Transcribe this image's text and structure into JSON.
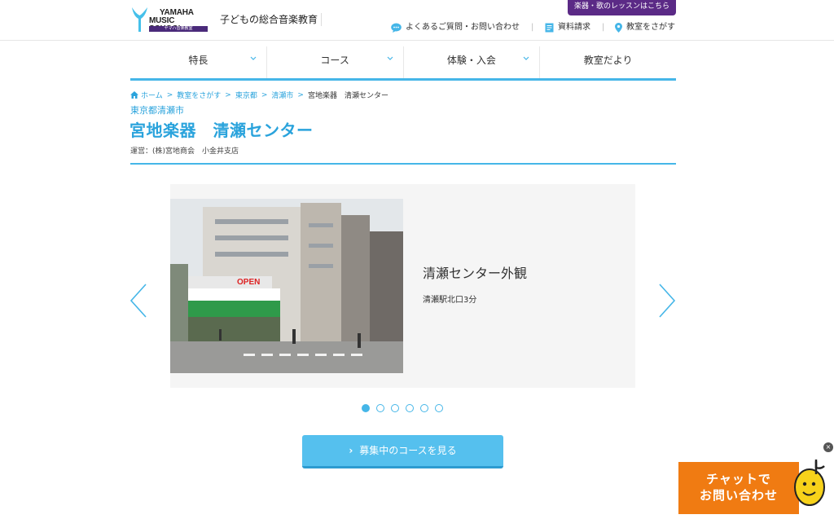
{
  "header": {
    "logo": {
      "line1": "YAMAHA",
      "line2": "MUSIC SCHOOL",
      "bar": "ヤマハ音楽教室"
    },
    "tagline": "子どもの総合音楽教育",
    "lesson_button": "楽器・歌のレッスンはこちら",
    "utility": {
      "faq": "よくあるご質問・お問い合わせ",
      "docs": "資料請求",
      "find": "教室をさがす",
      "separator": "|"
    }
  },
  "nav": {
    "items": [
      {
        "label": "特長"
      },
      {
        "label": "コース"
      },
      {
        "label": "体験・入会"
      },
      {
        "label": "教室だより"
      }
    ]
  },
  "breadcrumb": {
    "home": "ホーム",
    "find": "教室をさがす",
    "pref": "東京都",
    "city": "清瀬市",
    "current": "宮地楽器　清瀬センター",
    "sep": ">"
  },
  "page": {
    "region": "東京都清瀬市",
    "title": "宮地楽器　清瀬センター",
    "operator": "運営：(株)宮地商会　小金井支店"
  },
  "slider": {
    "title": "清瀬センター外観",
    "subtitle": "清瀬駅北口3分",
    "photo_sign": "OPEN",
    "slide_count": 6,
    "active_index": 0
  },
  "cta": {
    "label": "募集中のコースを見る",
    "caret": "›"
  },
  "chat": {
    "line1": "チャットで",
    "line2": "お問い合わせ",
    "close": "×"
  },
  "colors": {
    "accent": "#45b6e8",
    "link": "#2aa3dc",
    "brand_purple": "#5b2a86",
    "chat_orange": "#f07b12"
  }
}
